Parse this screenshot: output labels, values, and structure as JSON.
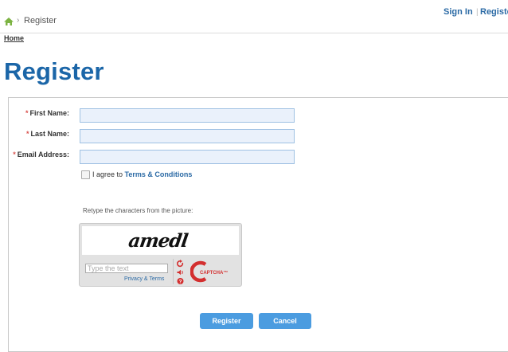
{
  "header": {
    "breadcrumb_current": "Register",
    "breadcrumb_separator": "›",
    "sign_in": "Sign In",
    "divider": "|",
    "register": "Register"
  },
  "nav": {
    "home": "Home"
  },
  "page": {
    "title": "Register"
  },
  "form": {
    "required_mark": "*",
    "first_name_label": "First Name:",
    "last_name_label": "Last Name:",
    "email_label": "Email Address:",
    "agree_prefix": "I agree to ",
    "terms_link": "Terms & Conditions",
    "agree_checked": false
  },
  "captcha": {
    "instruction": "Retype the characters from the picture:",
    "challenge_text": "amedl",
    "input_placeholder": "Type the text",
    "privacy_terms": "Privacy & Terms",
    "logo_text": "CAPTCHA™"
  },
  "buttons": {
    "register": "Register",
    "cancel": "Cancel"
  },
  "colors": {
    "accent": "#1b66a8",
    "link": "#2b6aa5",
    "button": "#4b9ce0",
    "required": "#d9534f",
    "input_bg": "#eaf1fb"
  }
}
